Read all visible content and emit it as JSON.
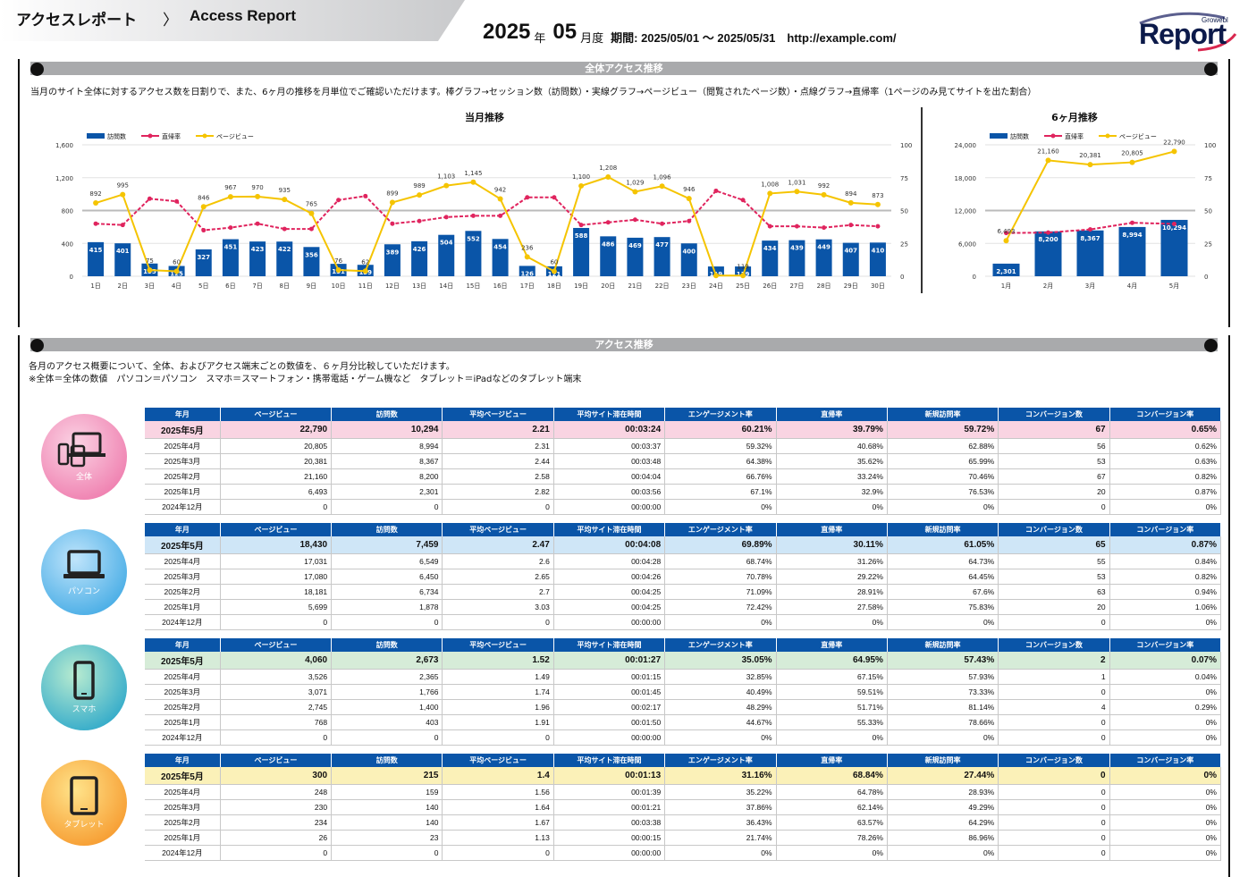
{
  "header": {
    "crumb1": "アクセスレポート",
    "arrow": "〉",
    "crumb2": "Access Report",
    "year": "2025",
    "year_unit": "年",
    "month": "05",
    "month_unit": "月度",
    "period": "期間: 2025/05/01 ～ 2025/05/31　http://example.com/",
    "logo_word": "Report",
    "logo_small": "Growebl"
  },
  "overall": {
    "title": "全体アクセス推移",
    "desc": "当月のサイト全体に対するアクセス数を日割りで、また、6ヶ月の推移を月単位でご確認いただけます。棒グラフ→セッション数（訪問数）・実線グラフ→ページビュー（閲覧されたページ数）・点線グラフ→直帰率（1ページのみ見てサイトを出た割合）"
  },
  "trend": {
    "title": "アクセス推移",
    "desc1": "各月のアクセス概要について、全体、およびアクセス端末ごとの数値を、６ヶ月分比較していただけます。",
    "desc2": "※全体＝全体の数値　パソコン＝パソコン　スマホ＝スマートフォン・携帯電話・ゲーム機など　タブレット＝iPadなどのタブレット端末"
  },
  "colors": {
    "bar": "#0a55a8",
    "bounce": "#e0245e",
    "pv": "#f5c400",
    "header_gray": "#a9aaac"
  },
  "chart_data": [
    {
      "type": "bar",
      "title": "当月推移",
      "legend": [
        "訪問数",
        "直帰率",
        "ページビュー"
      ],
      "legend_placement": "top-left",
      "categories": [
        "1日",
        "2日",
        "3日",
        "4日",
        "5日",
        "6日",
        "7日",
        "8日",
        "9日",
        "10日",
        "11日",
        "12日",
        "13日",
        "14日",
        "15日",
        "16日",
        "17日",
        "18日",
        "19日",
        "20日",
        "21日",
        "22日",
        "23日",
        "24日",
        "25日",
        "26日",
        "27日",
        "28日",
        "29日",
        "30日"
      ],
      "series": [
        {
          "name": "訪問数",
          "values": [
            415,
            401,
            155,
            125,
            327,
            451,
            423,
            422,
            356,
            151,
            139,
            389,
            426,
            504,
            552,
            454,
            126,
            121,
            588,
            486,
            469,
            477,
            400,
            119,
            119,
            434,
            439,
            449,
            407,
            410
          ]
        },
        {
          "name": "ページビュー",
          "values": [
            892,
            995,
            75,
            60,
            846,
            967,
            970,
            935,
            765,
            76,
            62,
            899,
            989,
            1103,
            1145,
            942,
            236,
            60,
            1100,
            1208,
            1029,
            1096,
            946,
            8,
            8,
            1008,
            1031,
            992,
            894,
            873
          ]
        },
        {
          "name": "直帰率",
          "values": [
            40,
            39,
            59,
            57,
            35,
            37,
            40,
            36,
            36,
            58,
            61,
            40,
            42,
            45,
            46,
            46,
            60,
            60,
            39,
            41,
            43,
            40,
            42,
            65,
            58,
            38,
            38,
            37,
            39,
            38
          ]
        }
      ],
      "ylim": [
        0,
        1600
      ],
      "yticks": [
        "0",
        "400",
        "800",
        "1,200",
        "1,600"
      ],
      "y2lim": [
        0,
        100
      ],
      "y2ticks": [
        "0",
        "25",
        "50",
        "75",
        "100"
      ],
      "grid": true,
      "bar_labels": [
        "415",
        "401",
        "155",
        "125",
        "327",
        "451",
        "423",
        "422",
        "356",
        "151",
        "139",
        "389",
        "426",
        "504",
        "552",
        "454",
        "126",
        "121",
        "588",
        "486",
        "469",
        "477",
        "400",
        "119",
        "119",
        "434",
        "439",
        "449",
        "407",
        "410"
      ],
      "pv_labels": [
        "892",
        "995",
        "75",
        "60",
        "846",
        "967",
        "970",
        "935",
        "765",
        "76",
        "62",
        "899",
        "989",
        "1,103",
        "1,145",
        "942",
        "236",
        "60",
        "1,100",
        "1,208",
        "1,029",
        "1,096",
        "946",
        "",
        "119",
        "1,008",
        "1,031",
        "992",
        "894",
        "873"
      ]
    },
    {
      "type": "bar",
      "title": "6ヶ月推移",
      "legend": [
        "訪問数",
        "直帰率",
        "ページビュー"
      ],
      "legend_placement": "top-left",
      "categories": [
        "1月",
        "2月",
        "3月",
        "4月",
        "5月"
      ],
      "series": [
        {
          "name": "訪問数",
          "values": [
            2301,
            8200,
            8367,
            8994,
            10294
          ]
        },
        {
          "name": "ページビュー",
          "values": [
            6493,
            21160,
            20381,
            20805,
            22790
          ]
        },
        {
          "name": "直帰率",
          "values": [
            32.9,
            33.24,
            35.62,
            40.68,
            39.79
          ]
        }
      ],
      "ylim": [
        0,
        24000
      ],
      "yticks": [
        "0",
        "6,000",
        "12,000",
        "18,000",
        "24,000"
      ],
      "y2lim": [
        0,
        100
      ],
      "y2ticks": [
        "0",
        "25",
        "50",
        "75",
        "100"
      ],
      "bar_labels": [
        "2,301",
        "8,200",
        "8,367",
        "8,994",
        "10,294"
      ],
      "pv_labels": [
        "6,493",
        "21,160",
        "20,381",
        "20,805",
        "22,790"
      ]
    }
  ],
  "table_headers": [
    "年月",
    "ページビュー",
    "訪問数",
    "平均ページビュー",
    "平均サイト滞在時間",
    "エンゲージメント率",
    "直帰率",
    "新規訪問率",
    "コンバージョン数",
    "コンバージョン率"
  ],
  "groups": [
    {
      "label": "全体",
      "hl": "#f9d4e2",
      "rows": [
        [
          "2025年5月",
          "22,790",
          "10,294",
          "2.21",
          "00:03:24",
          "60.21%",
          "39.79%",
          "59.72%",
          "67",
          "0.65%"
        ],
        [
          "2025年4月",
          "20,805",
          "8,994",
          "2.31",
          "00:03:37",
          "59.32%",
          "40.68%",
          "62.88%",
          "56",
          "0.62%"
        ],
        [
          "2025年3月",
          "20,381",
          "8,367",
          "2.44",
          "00:03:48",
          "64.38%",
          "35.62%",
          "65.99%",
          "53",
          "0.63%"
        ],
        [
          "2025年2月",
          "21,160",
          "8,200",
          "2.58",
          "00:04:04",
          "66.76%",
          "33.24%",
          "70.46%",
          "67",
          "0.82%"
        ],
        [
          "2025年1月",
          "6,493",
          "2,301",
          "2.82",
          "00:03:56",
          "67.1%",
          "32.9%",
          "76.53%",
          "20",
          "0.87%"
        ],
        [
          "2024年12月",
          "0",
          "0",
          "0",
          "00:00:00",
          "0%",
          "0%",
          "0%",
          "0",
          "0%"
        ]
      ]
    },
    {
      "label": "パソコン",
      "hl": "#cfe6f7",
      "rows": [
        [
          "2025年5月",
          "18,430",
          "7,459",
          "2.47",
          "00:04:08",
          "69.89%",
          "30.11%",
          "61.05%",
          "65",
          "0.87%"
        ],
        [
          "2025年4月",
          "17,031",
          "6,549",
          "2.6",
          "00:04:28",
          "68.74%",
          "31.26%",
          "64.73%",
          "55",
          "0.84%"
        ],
        [
          "2025年3月",
          "17,080",
          "6,450",
          "2.65",
          "00:04:26",
          "70.78%",
          "29.22%",
          "64.45%",
          "53",
          "0.82%"
        ],
        [
          "2025年2月",
          "18,181",
          "6,734",
          "2.7",
          "00:04:25",
          "71.09%",
          "28.91%",
          "67.6%",
          "63",
          "0.94%"
        ],
        [
          "2025年1月",
          "5,699",
          "1,878",
          "3.03",
          "00:04:25",
          "72.42%",
          "27.58%",
          "75.83%",
          "20",
          "1.06%"
        ],
        [
          "2024年12月",
          "0",
          "0",
          "0",
          "00:00:00",
          "0%",
          "0%",
          "0%",
          "0",
          "0%"
        ]
      ]
    },
    {
      "label": "スマホ",
      "hl": "#d6ecd8",
      "rows": [
        [
          "2025年5月",
          "4,060",
          "2,673",
          "1.52",
          "00:01:27",
          "35.05%",
          "64.95%",
          "57.43%",
          "2",
          "0.07%"
        ],
        [
          "2025年4月",
          "3,526",
          "2,365",
          "1.49",
          "00:01:15",
          "32.85%",
          "67.15%",
          "57.93%",
          "1",
          "0.04%"
        ],
        [
          "2025年3月",
          "3,071",
          "1,766",
          "1.74",
          "00:01:45",
          "40.49%",
          "59.51%",
          "73.33%",
          "0",
          "0%"
        ],
        [
          "2025年2月",
          "2,745",
          "1,400",
          "1.96",
          "00:02:17",
          "48.29%",
          "51.71%",
          "81.14%",
          "4",
          "0.29%"
        ],
        [
          "2025年1月",
          "768",
          "403",
          "1.91",
          "00:01:50",
          "44.67%",
          "55.33%",
          "78.66%",
          "0",
          "0%"
        ],
        [
          "2024年12月",
          "0",
          "0",
          "0",
          "00:00:00",
          "0%",
          "0%",
          "0%",
          "0",
          "0%"
        ]
      ]
    },
    {
      "label": "タブレット",
      "hl": "#fbf1b8",
      "rows": [
        [
          "2025年5月",
          "300",
          "215",
          "1.4",
          "00:01:13",
          "31.16%",
          "68.84%",
          "27.44%",
          "0",
          "0%"
        ],
        [
          "2025年4月",
          "248",
          "159",
          "1.56",
          "00:01:39",
          "35.22%",
          "64.78%",
          "28.93%",
          "0",
          "0%"
        ],
        [
          "2025年3月",
          "230",
          "140",
          "1.64",
          "00:01:21",
          "37.86%",
          "62.14%",
          "49.29%",
          "0",
          "0%"
        ],
        [
          "2025年2月",
          "234",
          "140",
          "1.67",
          "00:03:38",
          "36.43%",
          "63.57%",
          "64.29%",
          "0",
          "0%"
        ],
        [
          "2025年1月",
          "26",
          "23",
          "1.13",
          "00:00:15",
          "21.74%",
          "78.26%",
          "86.96%",
          "0",
          "0%"
        ],
        [
          "2024年12月",
          "0",
          "0",
          "0",
          "00:00:00",
          "0%",
          "0%",
          "0%",
          "0",
          "0%"
        ]
      ]
    }
  ]
}
